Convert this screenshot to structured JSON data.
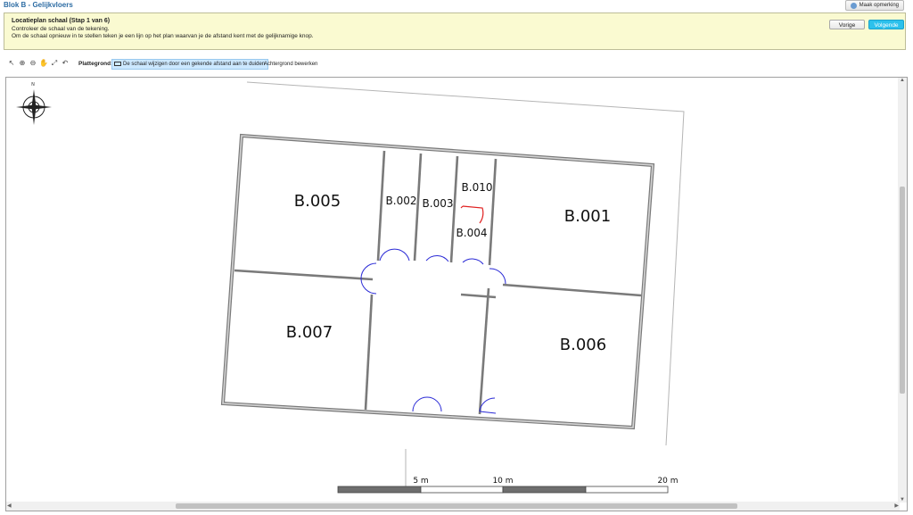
{
  "app": {
    "title": "Blok B - Gelijkvloers",
    "remark_button": "Maak opmerking"
  },
  "step_panel": {
    "title": "Locatieplan schaal (Stap 1 van 6)",
    "line1": "Controleer de schaal van de tekening.",
    "line2": "Om de schaal opnieuw in te stellen teken je een lijn op het plan waarvan je de afstand kent met de gelijknamige knop.",
    "prev_button": "Vorige",
    "next_button": "Volgende"
  },
  "toolbar": {
    "tools": [
      {
        "name": "pointer-icon",
        "glyph": "↖"
      },
      {
        "name": "zoom-in-icon",
        "glyph": "⊕"
      },
      {
        "name": "zoom-out-icon",
        "glyph": "⊖"
      },
      {
        "name": "pan-hand-icon",
        "glyph": "✋"
      },
      {
        "name": "fit-extent-icon",
        "glyph": "⤢"
      },
      {
        "name": "undo-icon",
        "glyph": "↶"
      }
    ],
    "label": "Plattegrond:",
    "scale_button": "De schaal wijzigen door een gekende afstand aan te duiden",
    "background_button": "Achtergrond bewerken"
  },
  "plan": {
    "compass_label": "N",
    "rooms": [
      "B.005",
      "B.002",
      "B.003",
      "B.010",
      "B.004",
      "B.001",
      "B.007",
      "B.006"
    ],
    "scale_labels": [
      "5 m",
      "10 m",
      "20 m"
    ],
    "colors": {
      "wall": "#7a7a7a",
      "door": "#2a2ad6",
      "door_highlight": "#e02020",
      "scalebar_dark": "#6e6e6e"
    }
  }
}
